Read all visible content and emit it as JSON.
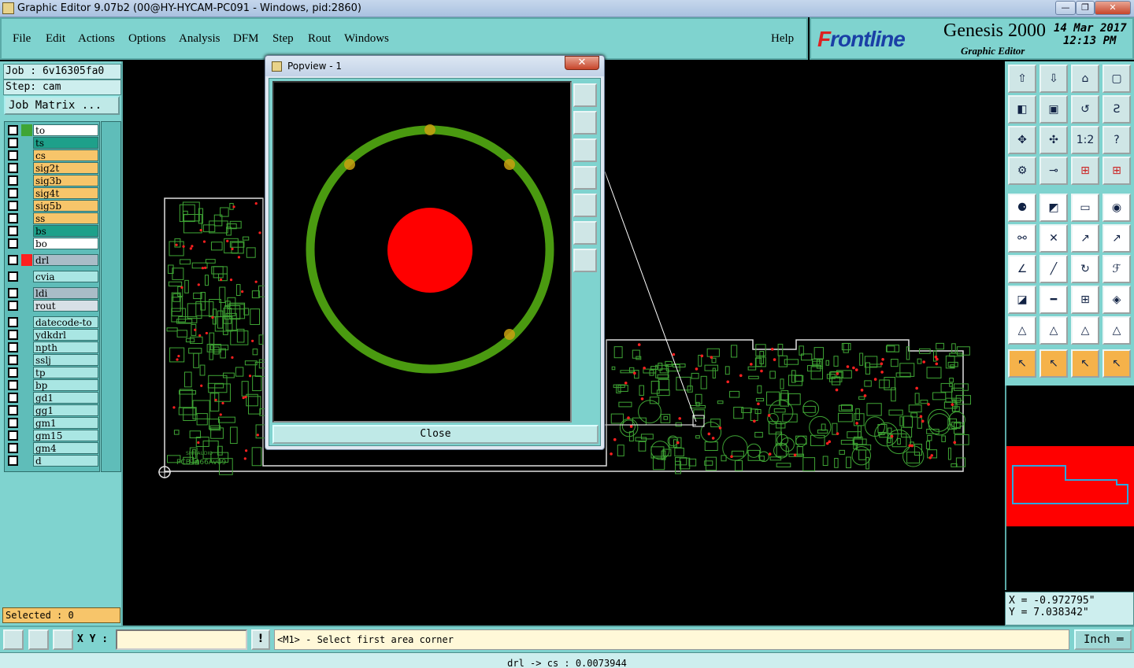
{
  "window": {
    "title": "Graphic Editor 9.07b2 (00@HY-HYCAM-PC091 - Windows, pid:2860)",
    "min": "—",
    "max": "❐",
    "close": "✕"
  },
  "menu": {
    "items": [
      "File",
      "Edit",
      "Actions",
      "Options",
      "Analysis",
      "DFM",
      "Step",
      "Rout",
      "Windows"
    ],
    "help": "Help"
  },
  "brand": {
    "logo_f": "F",
    "logo_rest": "rontline",
    "product": "Genesis 2000",
    "subtitle": "Graphic Editor",
    "date": "14 Mar 2017",
    "time": "12:13 PM"
  },
  "job": {
    "job_label": "Job : 6v16305fa0",
    "step_label": "Step: cam",
    "job_matrix": "Job Matrix ..."
  },
  "layers": [
    {
      "name": "to",
      "color": "#ffffff",
      "swatch": "#3fa535"
    },
    {
      "name": "ts",
      "color": "#1ea08a",
      "swatch": ""
    },
    {
      "name": "cs",
      "color": "#f7c56a",
      "swatch": ""
    },
    {
      "name": "sig2t",
      "color": "#f7c56a",
      "swatch": ""
    },
    {
      "name": "sig3b",
      "color": "#f7c56a",
      "swatch": ""
    },
    {
      "name": "sig4t",
      "color": "#f7c56a",
      "swatch": ""
    },
    {
      "name": "sig5b",
      "color": "#f7c56a",
      "swatch": ""
    },
    {
      "name": "ss",
      "color": "#f7c56a",
      "swatch": ""
    },
    {
      "name": "bs",
      "color": "#1ea08a",
      "swatch": ""
    },
    {
      "name": "bo",
      "color": "#ffffff",
      "swatch": ""
    },
    {
      "name": "drl",
      "color": "#a9bcc7",
      "swatch": "#ff2020"
    },
    {
      "name": "cvia",
      "color": "#a9e6e3",
      "swatch": ""
    },
    {
      "name": "ldi",
      "color": "#a9bcc7",
      "swatch": ""
    },
    {
      "name": "rout",
      "color": "#d7e0e6",
      "swatch": ""
    },
    {
      "name": "datecode-to",
      "color": "#a9e6e3",
      "swatch": ""
    },
    {
      "name": "ydkdrl",
      "color": "#a9e6e3",
      "swatch": ""
    },
    {
      "name": "npth",
      "color": "#a9e6e3",
      "swatch": ""
    },
    {
      "name": "sslj",
      "color": "#a9e6e3",
      "swatch": ""
    },
    {
      "name": "tp",
      "color": "#a9e6e3",
      "swatch": ""
    },
    {
      "name": "bp",
      "color": "#a9e6e3",
      "swatch": ""
    },
    {
      "name": "gd1",
      "color": "#a9e6e3",
      "swatch": ""
    },
    {
      "name": "gg1",
      "color": "#a9e6e3",
      "swatch": ""
    },
    {
      "name": "gm1",
      "color": "#a9e6e3",
      "swatch": ""
    },
    {
      "name": "gm15",
      "color": "#a9e6e3",
      "swatch": ""
    },
    {
      "name": "gm4",
      "color": "#a9e6e3",
      "swatch": ""
    },
    {
      "name": "d",
      "color": "#a9e6e3",
      "swatch": ""
    }
  ],
  "selected": "Selected : 0",
  "popview": {
    "title": "Popview - 1",
    "close_label": "Close"
  },
  "board_text": {
    "label": "PCB1466Av09",
    "sub": "SHR AUDIO"
  },
  "coords": {
    "x": "X = -0.972795\"",
    "y": "Y = 7.038342\""
  },
  "bottom": {
    "xy_label": "X Y :",
    "xy_value": "",
    "excl": "!",
    "prompt": "<M1> - Select first area corner",
    "unit": "Inch ═"
  },
  "status": "drl -> cs : 0.0073944",
  "colors": {
    "panel": "#7fd3cf",
    "ring": "#4a9a10",
    "pad": "#ff0000",
    "minimap_red": "#ff0000"
  },
  "icons": {
    "toolbar": [
      "zoom-home-icon",
      "zoom-page-icon",
      "home-icon",
      "window-icon",
      "pan-left-icon",
      "pan-right-icon",
      "flip-icon",
      "mirror-icon",
      "fit-icon",
      "center-icon",
      "scale-1-2-icon",
      "help-icon",
      "measure-icon",
      "snap-icon",
      "layers-red-icon",
      "layers-red2-icon",
      "cursor-icon",
      "draw-icon",
      "ruler-icon",
      "record-icon",
      "connect-icon",
      "cross-icon",
      "line-icon",
      "line2-icon",
      "angle-icon",
      "slash-icon",
      "rotate-icon",
      "ff-icon",
      "pad-icon",
      "minus-icon",
      "grid-icon",
      "shapes-icon",
      "tri-icon",
      "tri2-icon",
      "tri3-icon",
      "tri4-icon",
      "pointer-icon",
      "pointer-box-icon",
      "pointer-circle-icon",
      "pointer-tree-icon"
    ]
  }
}
